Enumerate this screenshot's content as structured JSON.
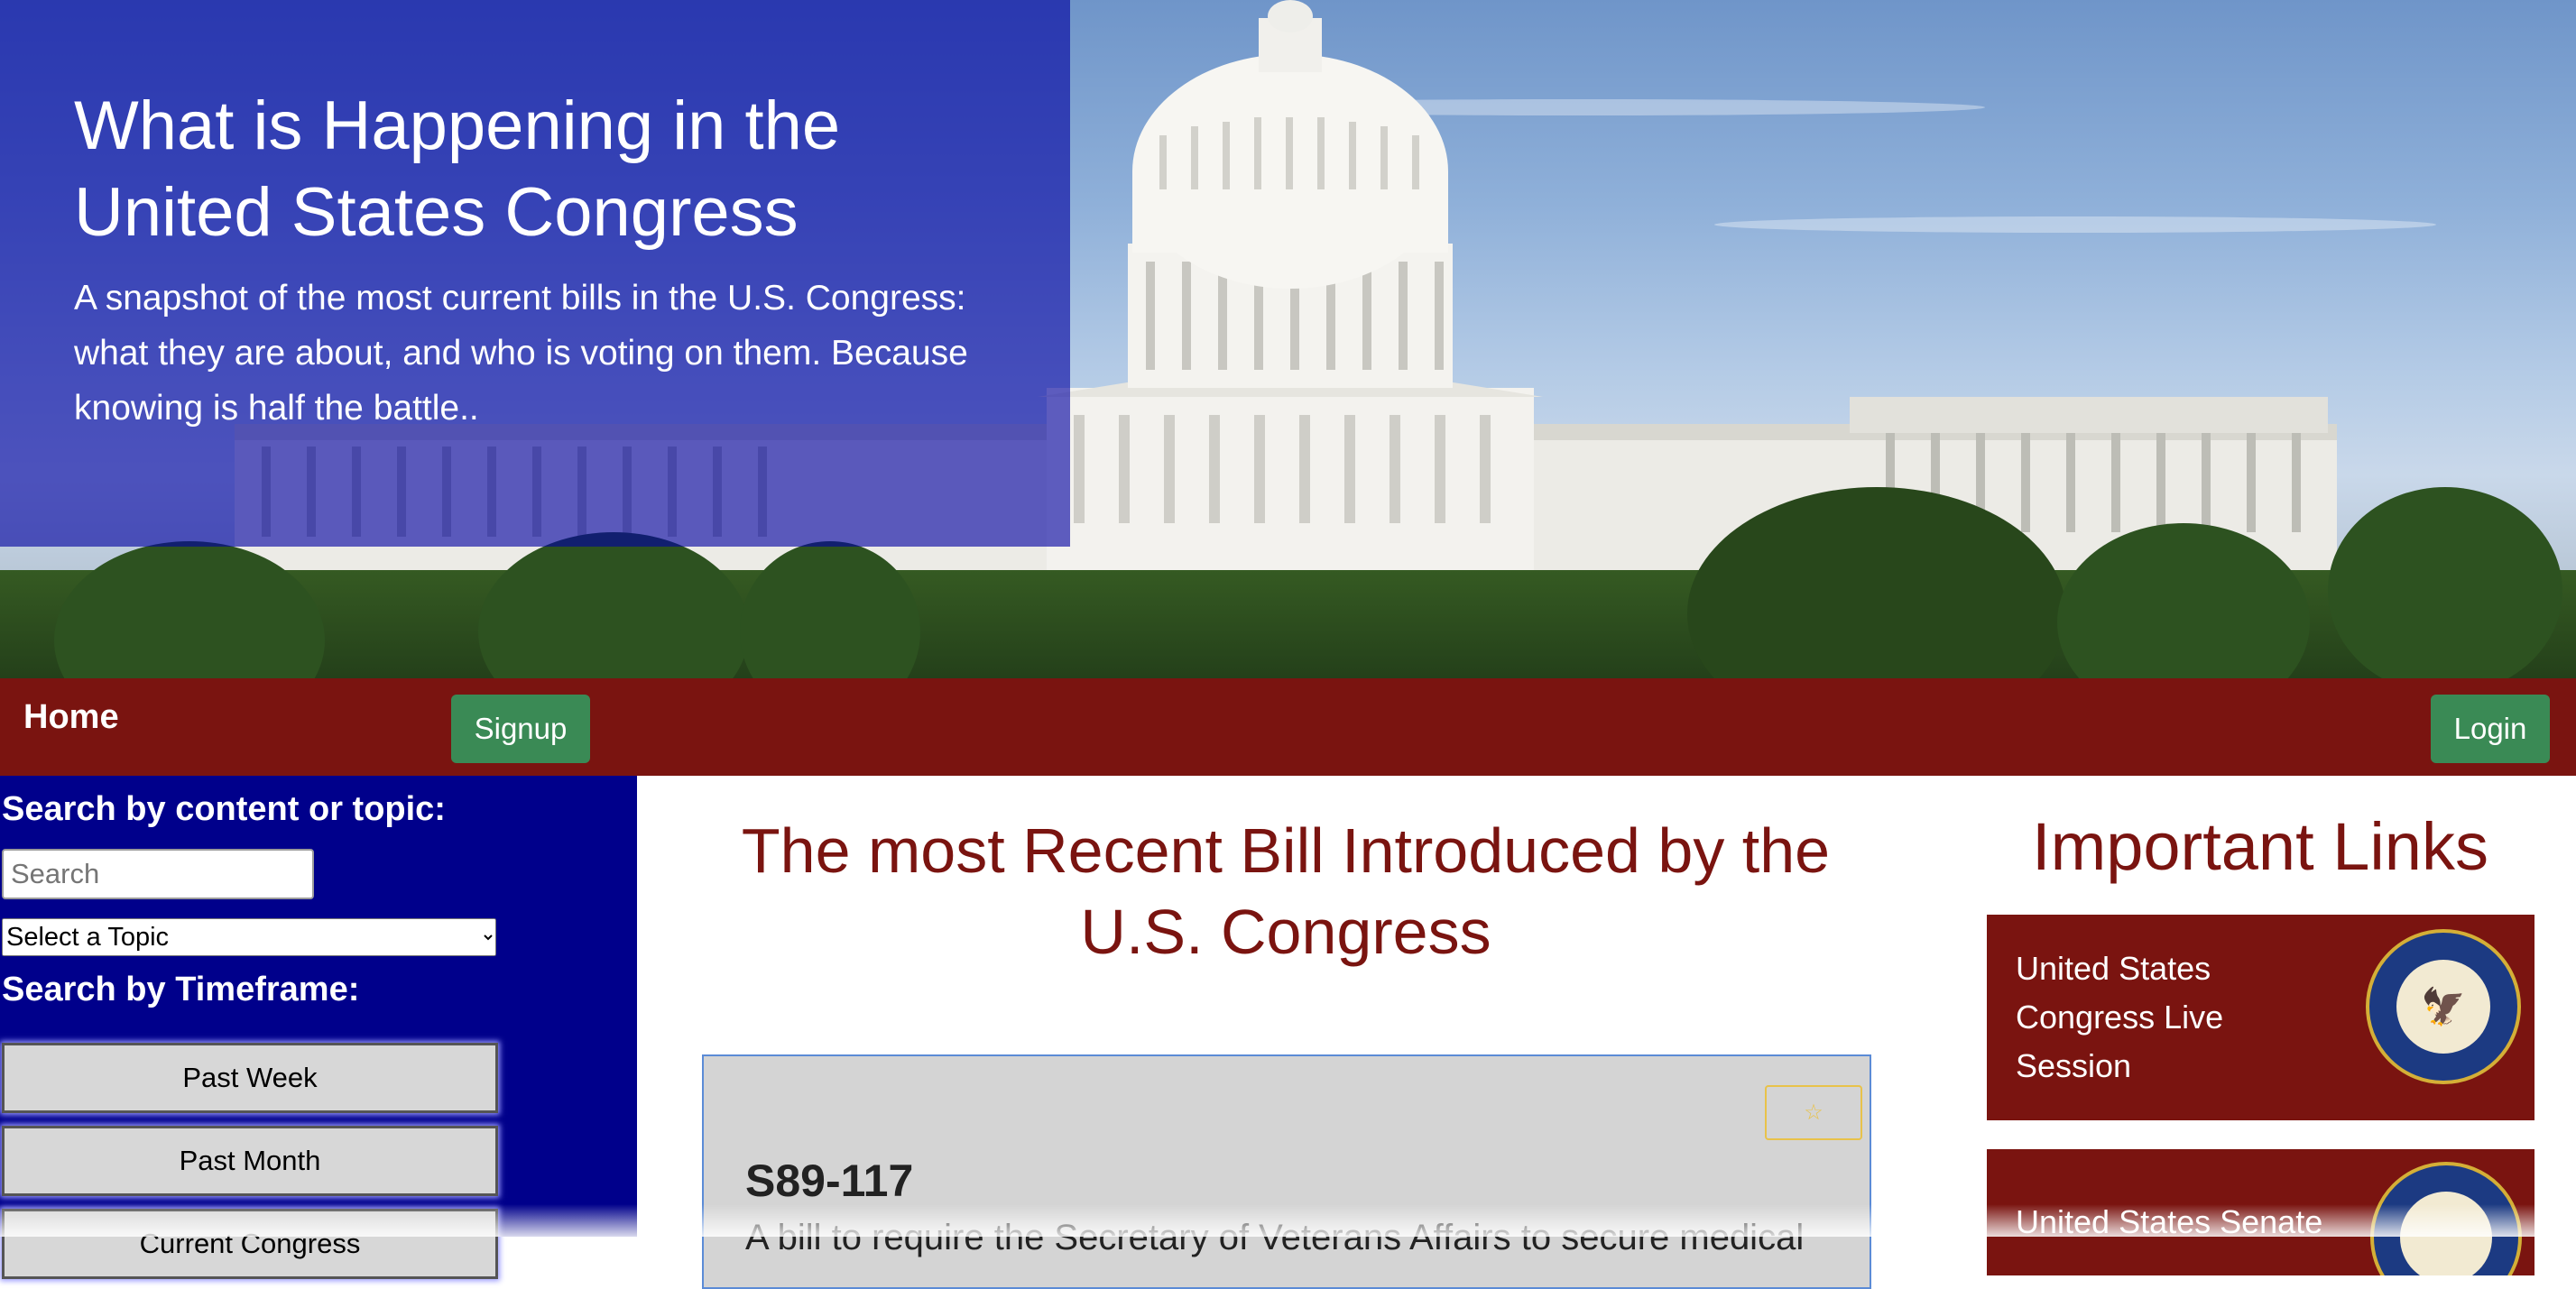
{
  "hero": {
    "title": "What is Happening in the United States Congress",
    "subtitle": "A snapshot of the most current bills in the U.S. Congress: what they are about, and who is voting on them. Because knowing is half the battle.."
  },
  "nav": {
    "home_label": "Home",
    "signup_label": "Signup",
    "login_label": "Login"
  },
  "sidebar": {
    "search_heading": "Search by content or topic:",
    "search_placeholder": "Search",
    "topic_select": "Select a Topic",
    "timeframe_heading": "Search by Timeframe:",
    "timeframes": [
      "Past Week",
      "Past Month",
      "Current Congress"
    ]
  },
  "main": {
    "title": "The most Recent Bill Introduced by the U.S. Congress",
    "bill": {
      "id": "S89-117",
      "description": "A bill to require the Secretary of Veterans Affairs to secure medical"
    },
    "favorite_icon": "star-icon"
  },
  "links": {
    "title": "Important Links",
    "items": [
      {
        "label": "United States Congress Live Session",
        "seal": "us-house-seal"
      },
      {
        "label": "United States Senate",
        "seal": "us-senate-seal"
      }
    ]
  },
  "colors": {
    "overlay": "#0000a0",
    "nav": "#7a1410",
    "green": "#3a8a55",
    "sidebar": "#00008b",
    "accent_text": "#7a1410"
  }
}
